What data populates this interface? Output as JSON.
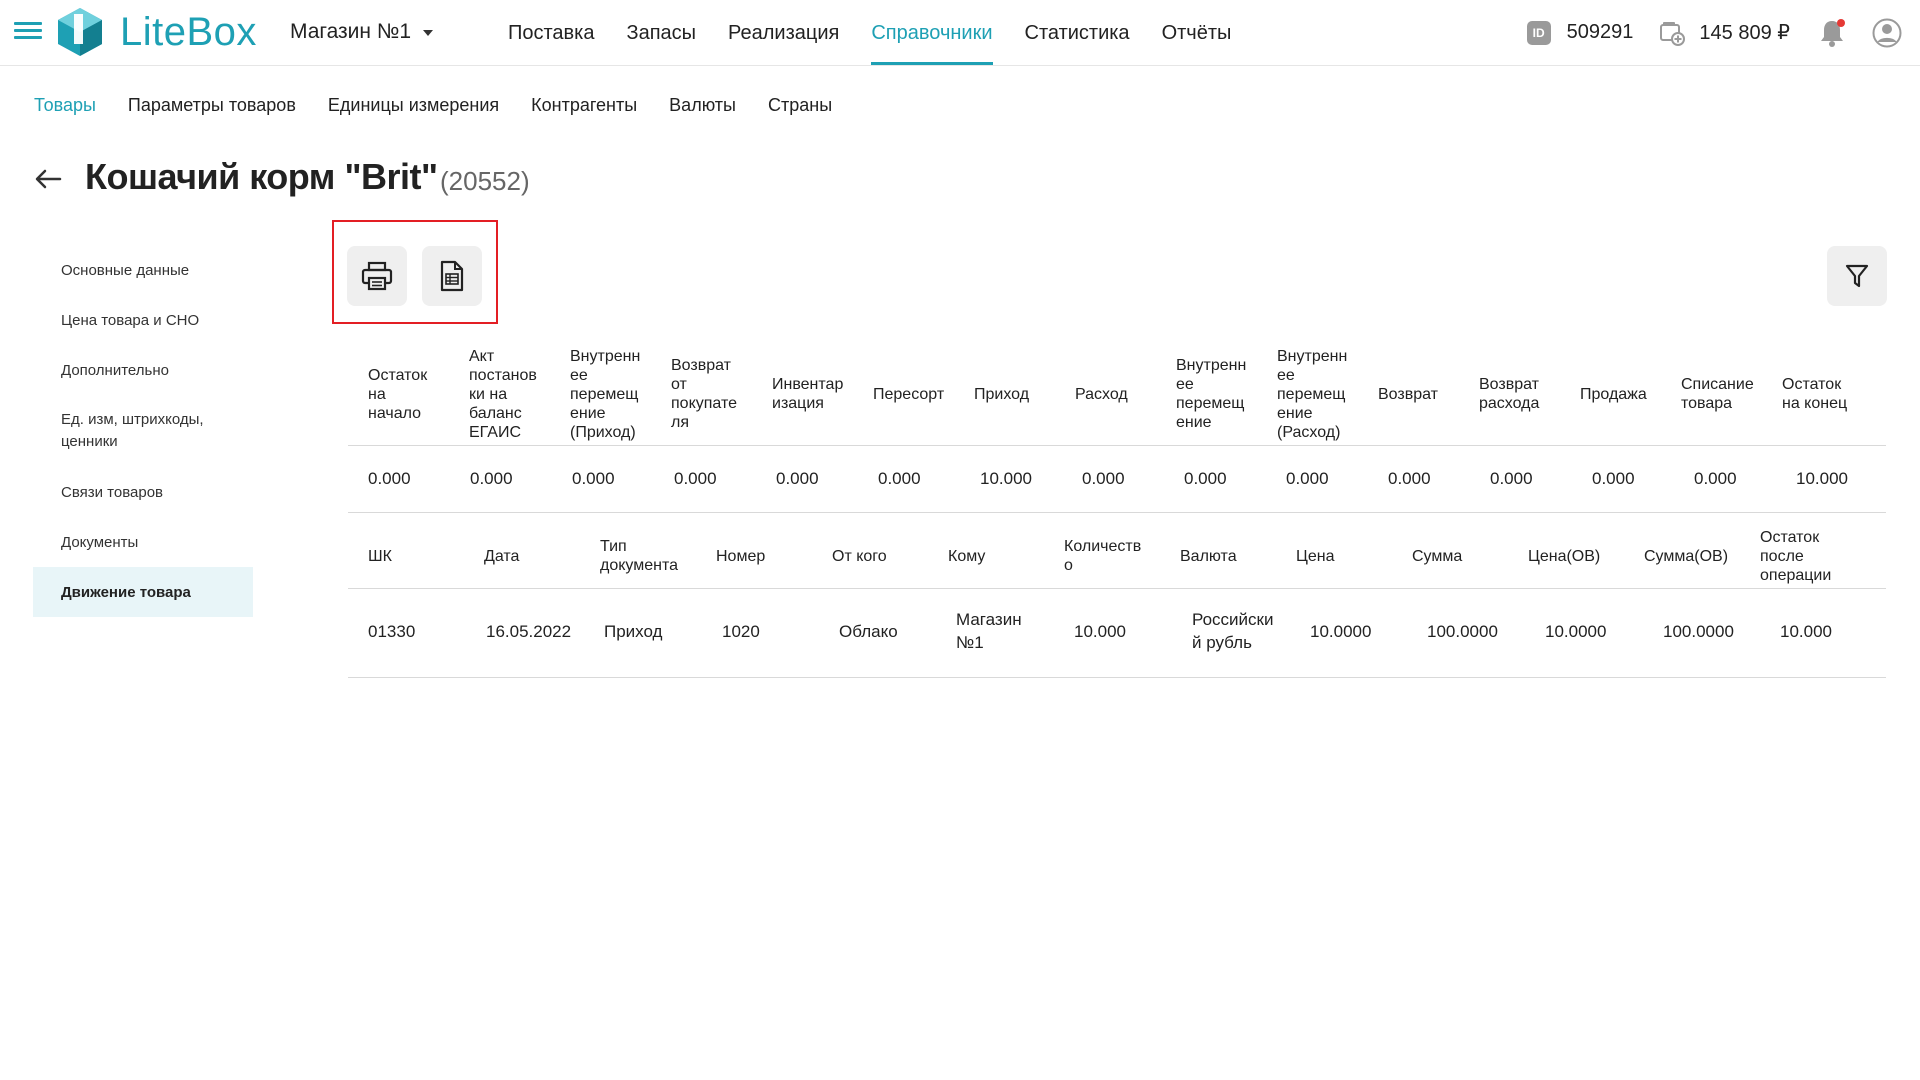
{
  "app": {
    "logo_text": "LiteBox",
    "store_name": "Магазин №1",
    "brand_color": "#1ea0b4"
  },
  "main_nav": [
    {
      "label": "Поставка",
      "active": false
    },
    {
      "label": "Запасы",
      "active": false
    },
    {
      "label": "Реализация",
      "active": false
    },
    {
      "label": "Справочники",
      "active": true
    },
    {
      "label": "Статистика",
      "active": false
    },
    {
      "label": "Отчёты",
      "active": false
    }
  ],
  "account": {
    "id_badge": "ID",
    "id_value": "509291",
    "balance": "145 809 ₽",
    "has_notifications": true
  },
  "sub_nav": [
    {
      "label": "Товары",
      "active": true
    },
    {
      "label": "Параметры товаров",
      "active": false
    },
    {
      "label": "Единицы измерения",
      "active": false
    },
    {
      "label": "Контрагенты",
      "active": false
    },
    {
      "label": "Валюты",
      "active": false
    },
    {
      "label": "Страны",
      "active": false
    }
  ],
  "product": {
    "title": "Кошачий корм \"Brit\"",
    "code": "(20552)"
  },
  "side_menu": [
    {
      "label": "Основные данные",
      "active": false
    },
    {
      "label": "Цена товара и СНО",
      "active": false
    },
    {
      "label": "Дополнительно",
      "active": false
    },
    {
      "label": "Ед. изм, штрихкоды, ценники",
      "active": false
    },
    {
      "label": "Связи товаров",
      "active": false
    },
    {
      "label": "Документы",
      "active": false
    },
    {
      "label": "Движение товара",
      "active": true
    }
  ],
  "toolbar": {
    "print_icon": "printer-icon",
    "export_icon": "document-icon",
    "filter_icon": "filter-icon"
  },
  "summary_table": {
    "headers": [
      "Остаток на начало",
      "Акт постановки на баланс ЕГАИС",
      "Внутреннее перемещение (Приход)",
      "Возврат от покупателя",
      "Инвентаризация",
      "Пересорт",
      "Приход",
      "Расход",
      "Внутреннее перемещение",
      "Внутреннее перемещение (Расход)",
      "Возврат",
      "Возврат расхода",
      "Продажа",
      "Списание товара",
      "Остаток на конец"
    ],
    "header_lines": [
      [
        "Остаток",
        "на",
        "начало"
      ],
      [
        "Акт",
        "постанов",
        "ки на",
        "баланс",
        "ЕГАИС"
      ],
      [
        "Внутренн",
        "ее",
        "перемещ",
        "ение",
        "(Приход)"
      ],
      [
        "Возврат",
        "от",
        "покупате",
        "ля"
      ],
      [
        "Инвентар",
        "изация"
      ],
      [
        "Пересорт"
      ],
      [
        "Приход"
      ],
      [
        "Расход"
      ],
      [
        "Внутренн",
        "ее",
        "перемещ",
        "ение"
      ],
      [
        "Внутренн",
        "ее",
        "перемещ",
        "ение",
        "(Расход)"
      ],
      [
        "Возврат"
      ],
      [
        "Возврат",
        "расхода"
      ],
      [
        "Продажа"
      ],
      [
        "Списание",
        "товара"
      ],
      [
        "Остаток",
        "на конец"
      ]
    ],
    "values": [
      "0.000",
      "0.000",
      "0.000",
      "0.000",
      "0.000",
      "0.000",
      "10.000",
      "0.000",
      "0.000",
      "0.000",
      "0.000",
      "0.000",
      "0.000",
      "0.000",
      "10.000"
    ]
  },
  "movement_table": {
    "headers": [
      "ШК",
      "Дата",
      "Тип документа",
      "Номер",
      "От кого",
      "Кому",
      "Количество",
      "Валюта",
      "Цена",
      "Сумма",
      "Цена(ОВ)",
      "Сумма(ОВ)",
      "Остаток после операции"
    ],
    "header_lines": [
      [
        "ШК"
      ],
      [
        "Дата"
      ],
      [
        "Тип",
        "документа"
      ],
      [
        "Номер"
      ],
      [
        "От кого"
      ],
      [
        "Кому"
      ],
      [
        "Количеств",
        "о"
      ],
      [
        "Валюта"
      ],
      [
        "Цена"
      ],
      [
        "Сумма"
      ],
      [
        "Цена(ОВ)"
      ],
      [
        "Сумма(ОВ)"
      ],
      [
        "Остаток",
        "после",
        "операции"
      ]
    ],
    "rows": [
      {
        "cells": [
          "01330",
          "16.05.2022",
          "Приход",
          "1020",
          "Облако",
          "Магазин №1",
          "10.000",
          "Российский рубль",
          "10.0000",
          "100.0000",
          "10.0000",
          "100.0000",
          "10.000"
        ],
        "cell_lines": [
          [
            "01330"
          ],
          [
            "16.05.2022"
          ],
          [
            "Приход"
          ],
          [
            "1020"
          ],
          [
            "Облако"
          ],
          [
            "Магазин",
            "№1"
          ],
          [
            "10.000"
          ],
          [
            "Российски",
            "й рубль"
          ],
          [
            "10.0000"
          ],
          [
            "100.0000"
          ],
          [
            "10.0000"
          ],
          [
            "100.0000"
          ],
          [
            "10.000"
          ]
        ]
      }
    ]
  }
}
